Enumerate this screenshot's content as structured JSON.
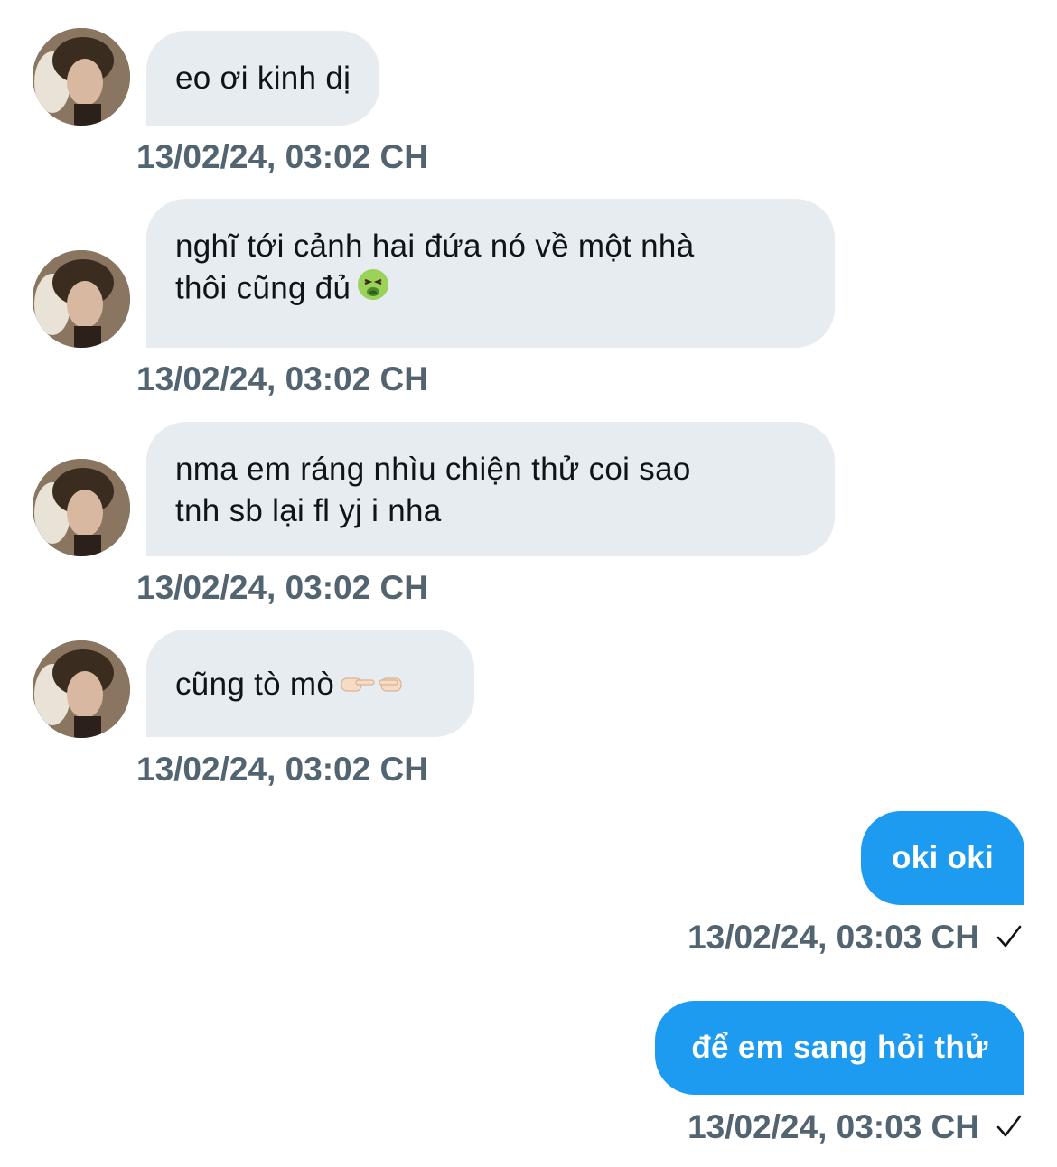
{
  "conversation": {
    "messages": [
      {
        "direction": "incoming",
        "lines": [
          "eo ơi kinh dị"
        ],
        "time": "13/02/24, 03:02 CH"
      },
      {
        "direction": "incoming",
        "lines": [
          "nghĩ tới cảnh hai đứa nó về một nhà",
          "thôi cũng đủ"
        ],
        "emoji": "nauseated-face",
        "time": "13/02/24, 03:02 CH"
      },
      {
        "direction": "incoming",
        "lines": [
          "nma em ráng nhìu chiện thử coi sao",
          "tnh sb lại fl yj i nha"
        ],
        "time": "13/02/24, 03:02 CH"
      },
      {
        "direction": "incoming",
        "lines": [
          "cũng tò mò"
        ],
        "emoji": "index-fingers-pointing-icon",
        "time": "13/02/24, 03:02 CH"
      },
      {
        "direction": "outgoing",
        "lines": [
          "oki oki"
        ],
        "time": "13/02/24, 03:03 CH",
        "status_icon": "check-icon"
      },
      {
        "direction": "outgoing",
        "lines": [
          "để em sang hỏi thử"
        ],
        "time": "13/02/24, 03:03 CH",
        "status_icon": "check-icon"
      }
    ]
  },
  "colors": {
    "incoming_bubble": "#e7ecf0",
    "outgoing_bubble": "#1d9bf0",
    "timestamp": "#536471",
    "text": "#0f1419"
  }
}
